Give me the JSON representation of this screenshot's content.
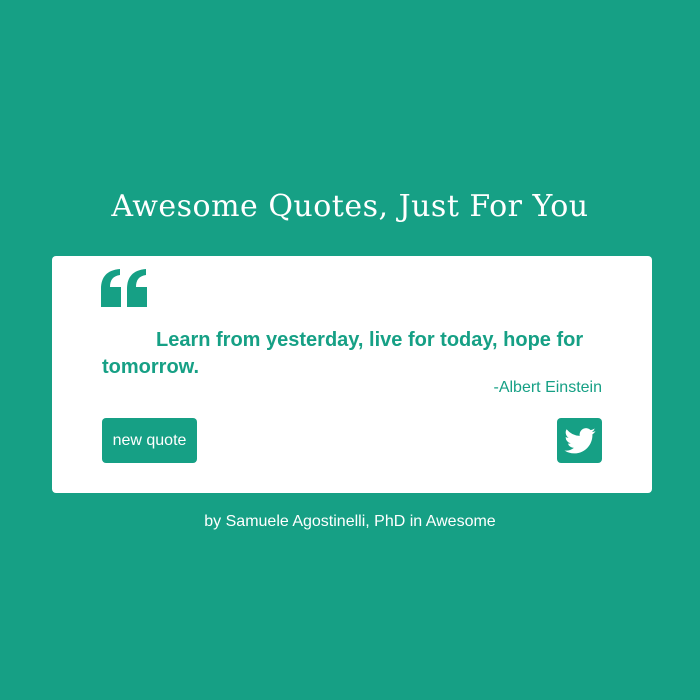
{
  "header": {
    "title": "Awesome Quotes, Just For You"
  },
  "quote_card": {
    "icon": "quote-left-icon",
    "text": "Learn from yesterday, live for today, hope for tomorrow.",
    "author": "-Albert Einstein",
    "new_quote_label": "new quote",
    "tweet_icon": "twitter-icon"
  },
  "footer": {
    "credit": "by Samuele Agostinelli, PhD in Awesome"
  },
  "colors": {
    "background": "#16a085",
    "card": "#ffffff",
    "accent": "#16a085",
    "text_light": "#ffffff"
  }
}
